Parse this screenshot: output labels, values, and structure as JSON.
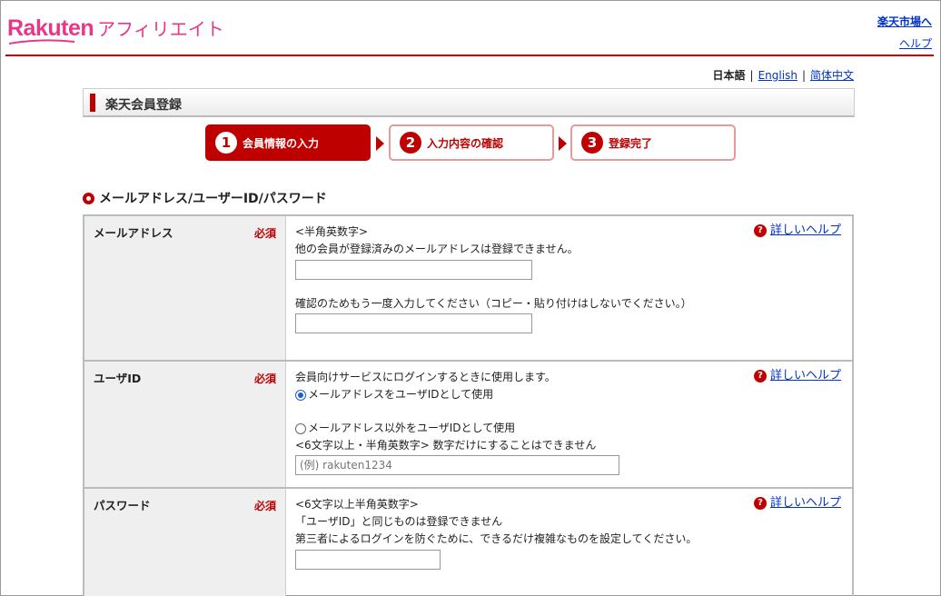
{
  "header": {
    "logo_main": "Rakuten",
    "logo_sub": "アフィリエイト",
    "link_ichiba": "楽天市場へ",
    "link_help": "ヘルプ"
  },
  "lang": {
    "current": "日本語",
    "english": "English",
    "chinese": "简体中文",
    "sep": "|"
  },
  "title": "楽天会員登録",
  "steps": [
    {
      "num": "1",
      "label": "会員情報の入力"
    },
    {
      "num": "2",
      "label": "入力内容の確認"
    },
    {
      "num": "3",
      "label": "登録完了"
    }
  ],
  "section_title": "メールアドレス/ユーザーID/パスワード",
  "required": "必須",
  "help_label": "詳しいヘルプ",
  "email": {
    "label": "メールアドレス",
    "note1": "<半角英数字>",
    "note2": "他の会員が登録済みのメールアドレスは登録できません。",
    "value": "",
    "confirm_note": "確認のためもう一度入力してください（コピー・貼り付けはしないでください。）",
    "confirm_value": ""
  },
  "userid": {
    "label": "ユーザID",
    "note": "会員向けサービスにログインするときに使用します。",
    "radio1": "メールアドレスをユーザIDとして使用",
    "radio2": "メールアドレス以外をユーザIDとして使用",
    "note2": "<6文字以上・半角英数字> 数字だけにすることはできません",
    "placeholder": "(例) rakuten1234"
  },
  "password": {
    "label": "パスワード",
    "note1": "<6文字以上半角英数字>",
    "note2": "「ユーザID」と同じものは登録できません",
    "note3": "第三者によるログインを防ぐために、できるだけ複雑なものを設定してください。",
    "value": ""
  },
  "colors": {
    "accent": "#bf0000",
    "brand_pink": "#e8378a",
    "link": "#0033cc"
  }
}
